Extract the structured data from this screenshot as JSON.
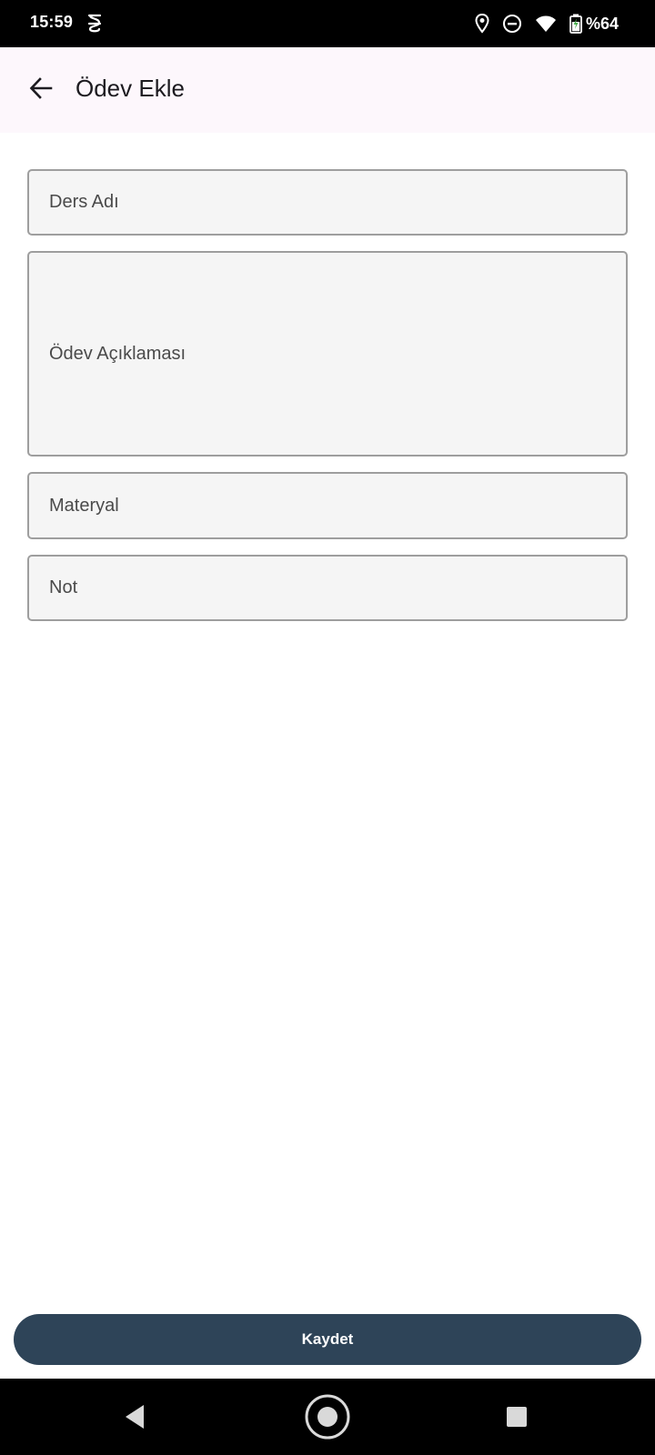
{
  "status_bar": {
    "time": "15:59",
    "left_icon": "notification-s-icon",
    "right_icons": [
      "location-icon",
      "do-not-disturb-icon",
      "wifi-icon",
      "battery-charging-icon"
    ],
    "battery": "%64"
  },
  "app_bar": {
    "back_icon": "arrow-back-icon",
    "title": "Ödev Ekle",
    "background": "#fdf7fc"
  },
  "form": {
    "fields": [
      {
        "label": "Ders Adı",
        "value": ""
      },
      {
        "label": "Ödev Açıklaması",
        "value": ""
      },
      {
        "label": "Materyal",
        "value": ""
      },
      {
        "label": "Not",
        "value": ""
      }
    ]
  },
  "actions": {
    "save_label": "Kaydet",
    "save_color": "#2e4458"
  },
  "nav_bar": {
    "icons": [
      "nav-back-icon",
      "nav-home-icon",
      "nav-recents-icon"
    ]
  }
}
